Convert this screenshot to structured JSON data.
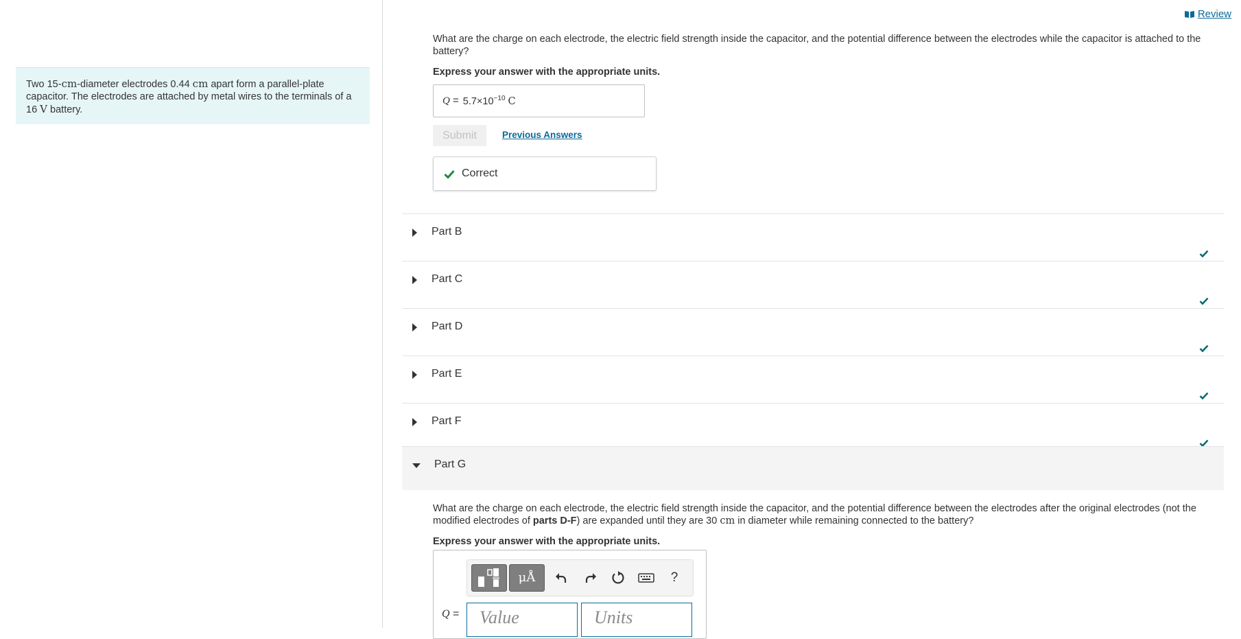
{
  "header": {
    "review_label": "Review"
  },
  "problem": {
    "text_1": "Two 15-",
    "unit_cm": "cm",
    "text_2": "-diameter electrodes 0.44 ",
    "text_3": " apart form a parallel-plate capacitor. The electrodes are attached by metal wires to the terminals of a",
    "voltage_value": "16",
    "unit_V": "V",
    "text_4": " battery."
  },
  "part_a": {
    "question": "What are the charge on each electrode, the electric field strength inside the capacitor, and the potential difference between the electrodes while the capacitor is attached to the battery?",
    "instruction": "Express your answer with the appropriate units.",
    "answer_var": "Q",
    "answer_eq": " = ",
    "answer_mantissa": "5.7×10",
    "answer_exponent": "−10",
    "answer_unit": "C",
    "submit_label": "Submit",
    "previous_answers_label": "Previous Answers",
    "feedback_label": "Correct"
  },
  "parts": [
    {
      "label": "Part B",
      "status": "correct"
    },
    {
      "label": "Part C",
      "status": "correct"
    },
    {
      "label": "Part D",
      "status": "correct"
    },
    {
      "label": "Part E",
      "status": "correct"
    },
    {
      "label": "Part F",
      "status": "correct"
    }
  ],
  "part_g": {
    "label": "Part G",
    "question_1": "What are the charge on each electrode, the electric field strength inside the capacitor, and the potential difference between the electrodes after the original electrodes (not the modified electrodes of ",
    "question_bold": "parts D-F",
    "question_2": ") are expanded until they are 30 ",
    "question_unit": "cm",
    "question_3": " in diameter while remaining connected to the battery?",
    "instruction": "Express your answer with the appropriate units.",
    "answer_var": "Q",
    "answer_eq": " =",
    "value_placeholder": "Value",
    "units_placeholder": "Units",
    "toolbar": {
      "units_label": "μÅ",
      "help_label": "?"
    }
  },
  "colors": {
    "accent": "#0b6a9a",
    "check_green": "#1a8a3a",
    "check_teal": "#0e6b73",
    "problem_bg": "#e6f6f7"
  }
}
